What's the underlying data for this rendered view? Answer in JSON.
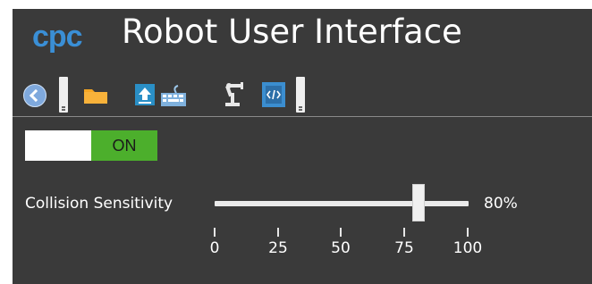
{
  "app": {
    "logo": "cpc",
    "title": "Robot User Interface"
  },
  "toolbar": {
    "icons": [
      "back-icon",
      "folder-icon",
      "upload-icon",
      "keyboard-icon",
      "robot-arm-icon",
      "code-icon"
    ]
  },
  "power_toggle": {
    "state_label": "ON",
    "on_color": "#4caf2c"
  },
  "collision_sensitivity": {
    "label": "Collision Sensitivity",
    "value_text": "80%",
    "value": 80,
    "min": 0,
    "max": 100,
    "ticks": [
      "0",
      "25",
      "50",
      "75",
      "100"
    ]
  }
}
